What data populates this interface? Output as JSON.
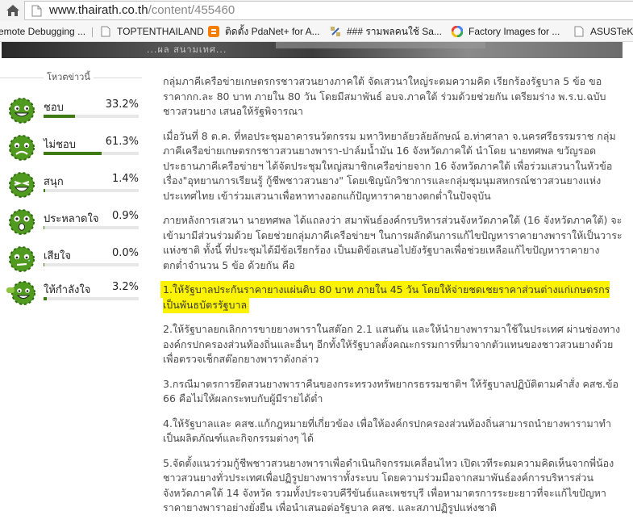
{
  "address_bar": {
    "url_host": "www.thairath.co.th",
    "url_path": "/content/455460"
  },
  "bookmarks": [
    {
      "label": "emote Debugging ...",
      "icon": "page-icon"
    },
    {
      "label": "TOPTENTHAILAND",
      "icon": "page-icon"
    },
    {
      "label": "ติดตั้ง PdaNet+ for A...",
      "icon": "blogger-icon"
    },
    {
      "label": "### รามพลคนใช้ Sa...",
      "icon": "satellite-icon"
    },
    {
      "label": "Factory Images for ...",
      "icon": "google-icon"
    },
    {
      "label": "ASUSTeK C",
      "icon": "page-icon"
    }
  ],
  "photo_strip": {
    "caption": "...ผล สนามเทศ..."
  },
  "poll": {
    "title": "โหวตข่าวนี้",
    "items": [
      {
        "label": "ชอบ",
        "percent_text": "33.2%",
        "value": 33.2,
        "mood": "happy"
      },
      {
        "label": "ไม่ชอบ",
        "percent_text": "61.3%",
        "value": 61.3,
        "mood": "sad"
      },
      {
        "label": "สนุก",
        "percent_text": "1.4%",
        "value": 1.4,
        "mood": "laugh"
      },
      {
        "label": "ประหลาดใจ",
        "percent_text": "0.9%",
        "value": 0.9,
        "mood": "surprised"
      },
      {
        "label": "เสียใจ",
        "percent_text": "0.0%",
        "value": 0.0,
        "mood": "upset"
      },
      {
        "label": "ให้กำลังใจ",
        "percent_text": "3.2%",
        "value": 3.2,
        "mood": "cheer"
      }
    ]
  },
  "article": {
    "paragraphs": [
      "กลุ่มภาคีเครือข่ายเกษตรกรชาวสวนยางภาคใต้ จัดเสวนาใหญ่ระดมความคิด เรียกร้องรัฐบาล 5 ข้อ ขอราคากก.ละ 80 บาท ภายใน 80 วัน โดยมีสมาพันธ์ อบจ.ภาคใต้ ร่วมด้วยช่วยกัน เตรียมร่าง พ.ร.บ.ฉบับชาวสวนยาง เสนอให้รัฐพิจารณา",
      "เมื่อวันที่ 8 ต.ค. ที่หอประชุมอาคารนวัตกรรม มหาวิทยาลัยวลัยลักษณ์ อ.ท่าศาลา จ.นครศรีธรรมราช กลุ่มภาคีเครือข่ายเกษตรกรชาวสวนยางพารา-ปาล์มน้ำมัน 16 จังหวัดภาคใต้ นำโดย นายทศพล ขวัญรอด ประธานภาคีเครือข่ายฯ ได้จัดประชุมใหญ่สมาชิกเครือข่ายจาก 16 จังหวัดภาคใต้ เพื่อร่วมเสวนาในหัวข้อเรื่อง\"อุทยานการเรียนรู้ กู้ชีพชาวสวนยาง\" โดยเชิญนักวิชาการและกลุ่มชุมนุมสหกรณ์ชาวสวนยางแห่งประเทศไทย เข้าร่วมเสวนาเพื่อหาทางออกแก้ปัญหาราคายางตกต่ำในปัจจุบัน",
      "ภายหลังการเสวนา นายทศพล ได้แถลงว่า สมาพันธ์องค์กรบริหารส่วนจังหวัดภาคใต้ (16 จังหวัดภาคใต้) จะเข้ามามีส่วนร่วมด้วย โดยช่วยกลุ่มภาคีเครือข่ายฯ ในการผลักดันการแก้ไขปัญหาราคายางพาราให้เป็นวาระแห่งชาติ ทั้งนี้ ที่ประชุมได้มีข้อเรียกร้อง เป็นมติข้อเสนอไปยังรัฐบาลเพื่อช่วยเหลือแก้ไขปัญหาราคายางตกต่ำจำนวน 5 ข้อ ด้วยกัน คือ",
      "1.ให้รัฐบาลประกันราคายางแผ่นดิบ 80 บาท ภายใน 45 วัน โดยให้จ่ายชดเชยราคาส่วนต่างแก่เกษตรกรเป็นพันธบัตรรัฐบาล",
      "2.ให้รัฐบาลยกเลิกการขายยางพาราในสต๊อก 2.1 แสนตัน และให้นำยางพารามาใช้ในประเทศ ผ่านช่องทางองค์กรปกครองส่วนท้องถิ่นและอื่นๆ อีกทั้งให้รัฐบาลตั้งคณะกรรมการที่มาจากตัวแทนของชาวสวนยางด้วย เพื่อตรวจเช็กสต๊อกยางพาราดังกล่าว",
      "3.กรณีมาตรการยึดสวนยางพาราคืนของกระทรวงทรัพยากรธรรมชาติฯ ให้รัฐบาลปฏิบัติตามคำสั่ง คสช.ข้อ 66 คือไม่ให้ผลกระทบกับผู้มีรายได้ต่ำ",
      "4.ให้รัฐบาลและ คสช.แก้กฎหมายที่เกี่ยวข้อง เพื่อให้องค์กรปกครองส่วนท้องถิ่นสามารถนำยางพารามาทำเป็นผลิตภัณฑ์และกิจกรรมต่างๆ ได้",
      "5.จัดตั้งแนวร่วมกู้ชีพชาวสวนยางพาราเพื่อดำเนินกิจกรรมเคลื่อนไหว เปิดเวทีระดมความคิดเห็นจากพี่น้องชาวสวนยางทั่วประเทศเพื่อปฏิรูปยางพาราทั้งระบบ โดยความร่วมมือจากสมาพันธ์องค์การบริหารส่วนจังหวัดภาคใต้ 14 จังหวัด รวมทั้งประจวบคีรีขันธ์และเพชรบุรี เพื่อหามาตรการระยะยาวที่จะแก้ไขปัญหาราคายางพาราอย่างยั่งยืน เพื่อนำเสนอต่อรัฐบาล คสช. และสภาปฏิรูปแห่งชาติ"
    ],
    "highlighted_paragraph_index": 3
  },
  "colors": {
    "poll_bar": "#3d7a14",
    "highlight": "#fbf300",
    "face_green": "#4f9a1f"
  }
}
